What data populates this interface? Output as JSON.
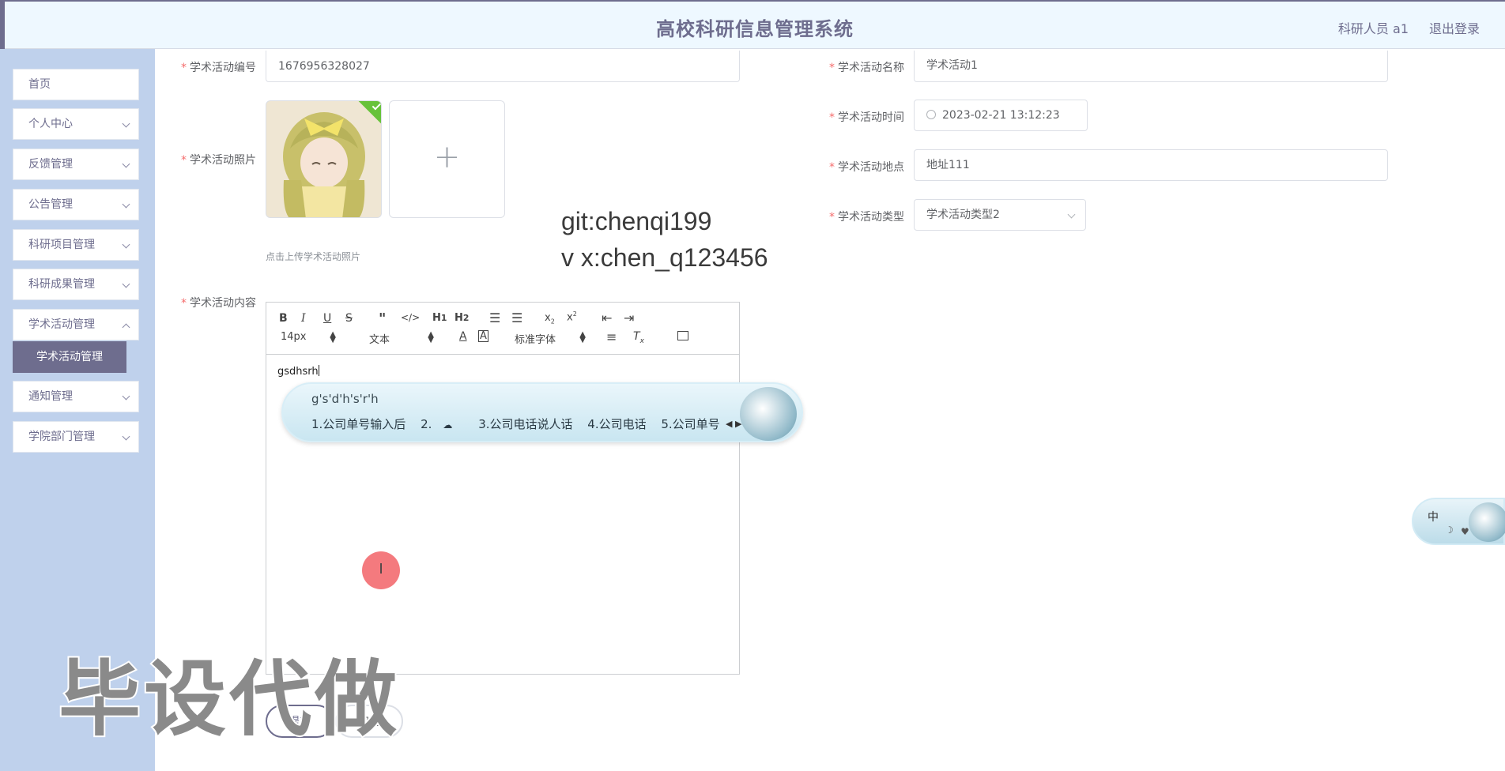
{
  "header": {
    "title": "高校科研信息管理系统",
    "user": "科研人员 a1",
    "logout": "退出登录"
  },
  "sidebar": {
    "items": [
      {
        "label": "首页"
      },
      {
        "label": "个人中心"
      },
      {
        "label": "反馈管理"
      },
      {
        "label": "公告管理"
      },
      {
        "label": "科研项目管理"
      },
      {
        "label": "科研成果管理"
      },
      {
        "label": "学术活动管理"
      },
      {
        "label": "通知管理"
      },
      {
        "label": "学院部门管理"
      }
    ],
    "active_sub": "学术活动管理"
  },
  "form": {
    "code_label": "学术活动编号",
    "code_value": "1676956328027",
    "name_label": "学术活动名称",
    "name_value": "学术活动1",
    "photo_label": "学术活动照片",
    "photo_hint": "点击上传学术活动照片",
    "time_label": "学术活动时间",
    "time_value": "2023-02-21 13:12:23",
    "place_label": "学术活动地点",
    "place_value": "地址111",
    "type_label": "学术活动类型",
    "type_value": "学术活动类型2",
    "content_label": "学术活动内容"
  },
  "editor": {
    "font_size": "14px",
    "block": "文本",
    "font_family": "标准字体",
    "content": "gsdhsrh"
  },
  "ime": {
    "composition": "g's'd'h's'r'h",
    "candidates": [
      "1.公司单号输入后",
      "2.",
      "3.公司电话说人话",
      "4.公司电话",
      "5.公司单号"
    ],
    "mode": "中"
  },
  "watermarks": {
    "git": "git:chenqi199",
    "vx": "v x:chen_q123456",
    "big": "毕设代做"
  },
  "buttons": {
    "submit": "提交",
    "cancel": "取消"
  }
}
